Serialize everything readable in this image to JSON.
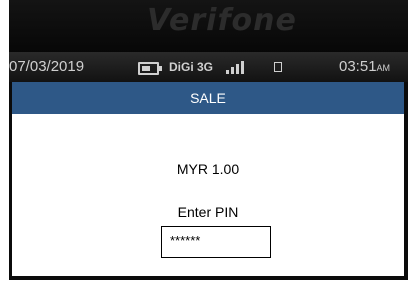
{
  "device": {
    "brand": "Verifone"
  },
  "status_bar": {
    "date": "07/03/2019",
    "carrier": "DiGi 3G",
    "time": "03:51",
    "time_suffix": "AM",
    "icons": [
      "battery-icon",
      "signal-icon",
      "lock-icon"
    ]
  },
  "screen": {
    "title": "SALE",
    "amount": "MYR 1.00",
    "prompt": "Enter PIN",
    "pin_value": "******"
  },
  "colors": {
    "title_bar": "#2e5887",
    "screen_background": "#ffffff",
    "bezel": "#0b0b0b"
  }
}
